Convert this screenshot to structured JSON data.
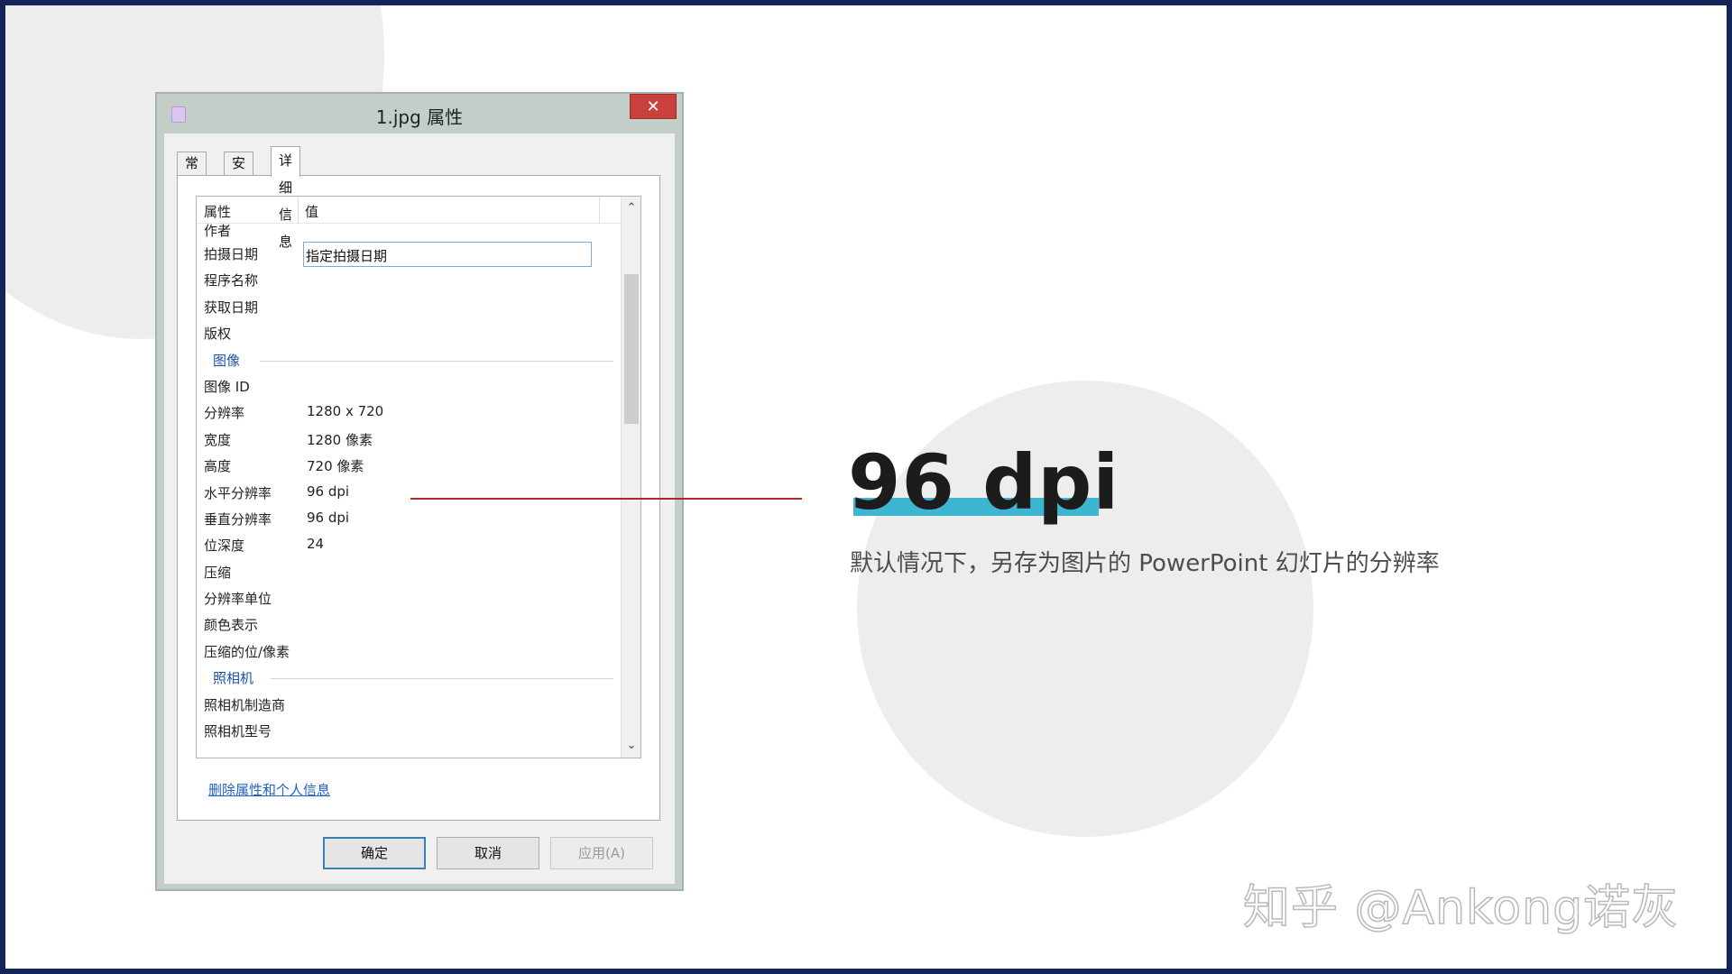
{
  "dialog": {
    "title": "1.jpg 属性",
    "close_glyph": "✕",
    "tabs": [
      {
        "label": "常规"
      },
      {
        "label": "安全"
      },
      {
        "label": "详细信息"
      }
    ],
    "list": {
      "col_property": "属性",
      "col_value": "值",
      "rows": [
        {
          "key": "作者",
          "value": ""
        },
        {
          "key": "拍摄日期",
          "value": "",
          "edit_value": "指定拍摄日期"
        },
        {
          "key": "程序名称",
          "value": ""
        },
        {
          "key": "获取日期",
          "value": ""
        },
        {
          "key": "版权",
          "value": ""
        },
        {
          "key": "图像",
          "group": true
        },
        {
          "key": "图像 ID",
          "value": ""
        },
        {
          "key": "分辨率",
          "value": "1280 x 720"
        },
        {
          "key": "宽度",
          "value": "1280 像素"
        },
        {
          "key": "高度",
          "value": "720 像素"
        },
        {
          "key": "水平分辨率",
          "value": "96 dpi"
        },
        {
          "key": "垂直分辨率",
          "value": "96 dpi"
        },
        {
          "key": "位深度",
          "value": "24"
        },
        {
          "key": "压缩",
          "value": ""
        },
        {
          "key": "分辨率单位",
          "value": ""
        },
        {
          "key": "颜色表示",
          "value": ""
        },
        {
          "key": "压缩的位/像素",
          "value": ""
        },
        {
          "key": "照相机",
          "group": true
        },
        {
          "key": "照相机制造商",
          "value": ""
        },
        {
          "key": "照相机型号",
          "value": ""
        }
      ],
      "scroll_up_glyph": "⌃",
      "scroll_down_glyph": "⌄"
    },
    "remove_link": "删除属性和个人信息",
    "buttons": {
      "ok": "确定",
      "cancel": "取消",
      "apply": "应用(A)"
    }
  },
  "callout": {
    "headline": "96 dpi",
    "description": "默认情况下，另存为图片的 PowerPoint 幻灯片的分辨率",
    "accent_color": "#3eb6d2",
    "line_color": "#b4242c"
  },
  "watermark": "知乎 @Ankong诺灰"
}
